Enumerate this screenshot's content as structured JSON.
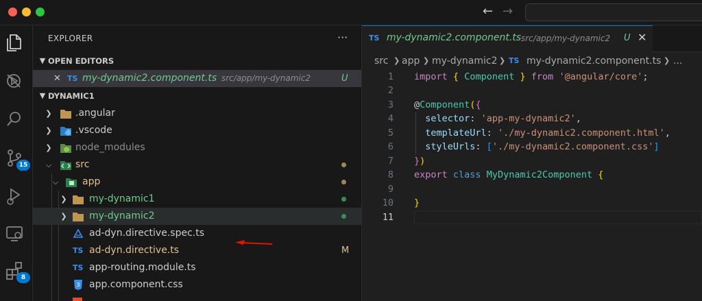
{
  "window": {
    "nav_back": "←",
    "nav_forward": "→"
  },
  "activity_bar": {
    "scm_badge": "15",
    "extensions_badge": "8"
  },
  "sidebar": {
    "title": "EXPLORER",
    "more": "···",
    "open_editors": {
      "label": "OPEN EDITORS",
      "item": {
        "close": "✕",
        "lang": "TS",
        "name": "my-dynamic2.component.ts",
        "path": "src/app/my-dynamic2",
        "status": "U"
      }
    },
    "workspace": {
      "label": "DYNAMIC1",
      "items": [
        {
          "label": ".angular"
        },
        {
          "label": ".vscode"
        },
        {
          "label": "node_modules"
        },
        {
          "label": "src"
        },
        {
          "label": "app"
        },
        {
          "label": "my-dynamic1"
        },
        {
          "label": "my-dynamic2"
        },
        {
          "label": "ad-dyn.directive.spec.ts"
        },
        {
          "label": "ad-dyn.directive.ts",
          "status": "M"
        },
        {
          "label": "app-routing.module.ts"
        },
        {
          "label": "app.component.css"
        }
      ]
    }
  },
  "tab": {
    "lang": "TS",
    "name": "my-dynamic2.component.ts",
    "path": "src/app/my-dynamic2",
    "status": "U",
    "close": "✕"
  },
  "breadcrumb": {
    "items": [
      "src",
      "app",
      "my-dynamic2",
      "my-dynamic2.component.ts",
      "..."
    ],
    "lang": "TS"
  },
  "editor": {
    "line_numbers": [
      "1",
      "2",
      "3",
      "4",
      "5",
      "6",
      "7",
      "8",
      "9",
      "10",
      "11"
    ],
    "line1": {
      "kw": "import",
      "ob": "{",
      "name": "Component",
      "cb": "}",
      "from": "from",
      "mod": "'@angular/core'",
      "semi": ";"
    },
    "line3": {
      "at": "@",
      "dec": "Component",
      "op": "(",
      "ob": "{"
    },
    "line4": {
      "key": "selector",
      "colon": ":",
      "val": "'app-my-dynamic2'",
      "comma": ","
    },
    "line5": {
      "key": "templateUrl",
      "colon": ":",
      "val": "'./my-dynamic2.component.html'",
      "comma": ","
    },
    "line6": {
      "key": "styleUrls",
      "colon": ":",
      "ob": "[",
      "val": "'./my-dynamic2.component.css'",
      "cb": "]"
    },
    "line7": {
      "cb": "}",
      "cp": ")"
    },
    "line8": {
      "export": "export",
      "class": "class",
      "name": "MyDynamic2Component",
      "ob": "{"
    },
    "line10": {
      "cb": "}"
    }
  },
  "colors": {
    "accent": "#0078d4",
    "added": "#73c991",
    "modified": "#e2c08d",
    "arrow": "#e51400"
  }
}
